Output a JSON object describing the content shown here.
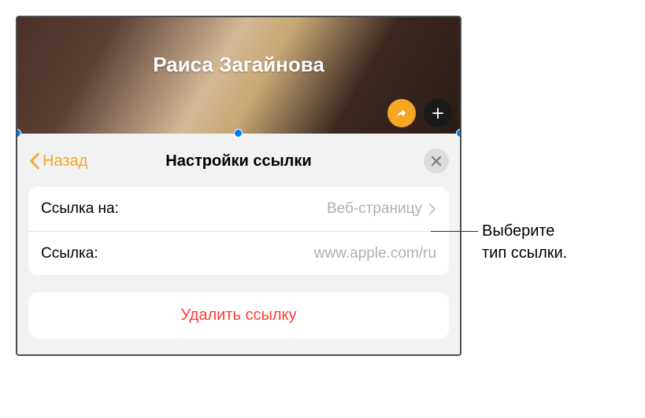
{
  "header": {
    "title": "Раиса Загайнова"
  },
  "popover": {
    "back_label": "Назад",
    "title": "Настройки ссылки",
    "rows": {
      "link_to": {
        "label": "Ссылка на:",
        "value": "Веб-страницу"
      },
      "link": {
        "label": "Ссылка:",
        "value": "www.apple.com/ru"
      }
    },
    "delete_label": "Удалить ссылку"
  },
  "callout": {
    "line1": "Выберите",
    "line2": "тип ссылки."
  }
}
